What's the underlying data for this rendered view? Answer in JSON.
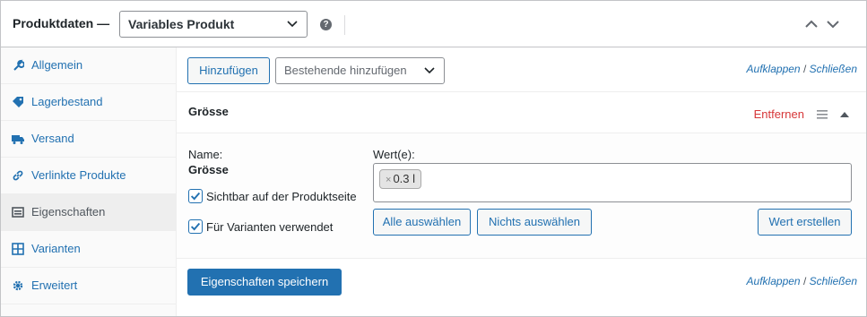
{
  "header": {
    "title": "Produktdaten —",
    "product_type": "Variables Produkt",
    "help_icon": "question-icon",
    "collapse_icon": "chevron-up-icon",
    "expand_icon": "chevron-down-icon"
  },
  "sidebar": {
    "items": [
      {
        "label": "Allgemein",
        "icon": "wrench-icon"
      },
      {
        "label": "Lagerbestand",
        "icon": "tag-icon"
      },
      {
        "label": "Versand",
        "icon": "truck-icon"
      },
      {
        "label": "Verlinkte Produkte",
        "icon": "link-icon"
      },
      {
        "label": "Eigenschaften",
        "icon": "list-icon"
      },
      {
        "label": "Varianten",
        "icon": "grid-icon"
      },
      {
        "label": "Erweitert",
        "icon": "gear-icon"
      }
    ],
    "active_index": 4
  },
  "toolbar": {
    "add_label": "Hinzufügen",
    "existing_placeholder": "Bestehende hinzufügen",
    "expand_label": "Aufklappen",
    "separator": "/",
    "close_label": "Schließen"
  },
  "attribute": {
    "name": "Grösse",
    "remove_label": "Entfernen",
    "name_label": "Name:",
    "name_value": "Grösse",
    "values_label": "Wert(e):",
    "values": [
      "0.3 l"
    ],
    "visible_label": "Sichtbar auf der Produktseite",
    "visible_checked": true,
    "variations_label": "Für Varianten verwendet",
    "variations_checked": true,
    "select_all_label": "Alle auswählen",
    "select_none_label": "Nichts auswählen",
    "create_value_label": "Wert erstellen"
  },
  "footer": {
    "save_label": "Eigenschaften speichern",
    "expand_label": "Aufklappen",
    "separator": "/",
    "close_label": "Schließen"
  },
  "colors": {
    "accent": "#2271b1",
    "danger": "#d63638"
  }
}
